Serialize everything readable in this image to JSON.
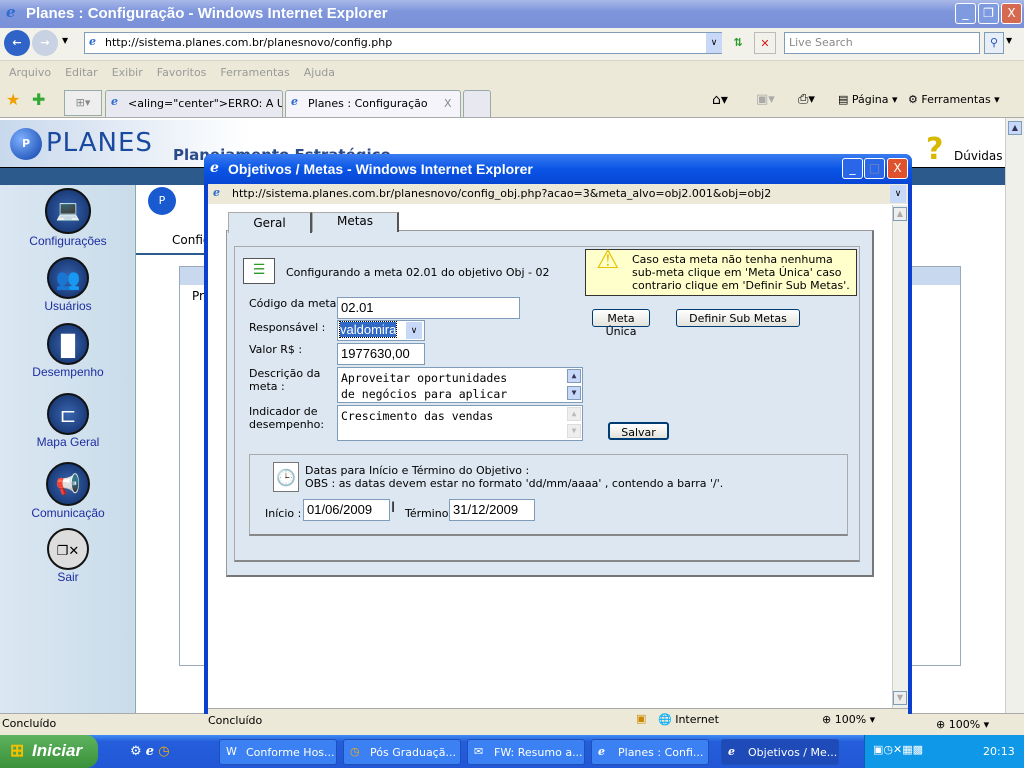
{
  "browser": {
    "title": "Planes : Configuração - Windows Internet Explorer",
    "url": "http://sistema.planes.com.br/planesnovo/config.php",
    "search_placeholder": "Live Search",
    "menu": [
      "Arquivo",
      "Editar",
      "Exibir",
      "Favoritos",
      "Ferramentas",
      "Ajuda"
    ],
    "tabs": [
      {
        "label": "<aling=\"center\">ERRO: A U..."
      },
      {
        "label": "Planes : Configuração",
        "close": "X"
      }
    ],
    "toolbar": {
      "page": "Página",
      "tools": "Ferramentas"
    },
    "status": "Concluído",
    "zoom": "100%"
  },
  "site": {
    "logo": "PLANES",
    "header_title": "Planejamento Estratégico",
    "help": "Dúvidas",
    "nav": [
      {
        "label": "Configurações"
      },
      {
        "label": "Usuários"
      },
      {
        "label": "Desempenho"
      },
      {
        "label": "Mapa Geral"
      },
      {
        "label": "Comunicação"
      },
      {
        "label": "Sair"
      }
    ],
    "content_tab": "Configurações",
    "content_col": "Pr"
  },
  "popup": {
    "title": "Objetivos / Metas - Windows Internet Explorer",
    "url": "http://sistema.planes.com.br/planesnovo/config_obj.php?acao=3&meta_alvo=obj2.001&obj=obj2",
    "tabs": [
      "Geral",
      "Metas"
    ],
    "heading": "Configurando a meta 02.01 do objetivo Obj - 02",
    "warning": "Caso esta meta não tenha nenhuma sub-meta clique em 'Meta Única' caso  contrario clique em 'Definir Sub Metas'.",
    "fields": {
      "codigo_label": "Código da meta :",
      "codigo": "02.01",
      "resp_label": "Responsável :",
      "resp": "valdomira",
      "valor_label": "Valor R$ :",
      "valor": "1977630,00",
      "desc_label": "Descrição da meta :",
      "desc": "Aproveitar oportunidades\nde negócios para aplicar",
      "ind_label": "Indicador de desempenho:",
      "ind": "Crescimento das vendas"
    },
    "buttons": {
      "meta_unica": "Meta Única",
      "sub_metas": "Definir Sub Metas",
      "salvar": "Salvar"
    },
    "dates": {
      "title": "Datas para Início e Término do Objetivo :",
      "obs": "OBS : as datas devem estar no formato 'dd/mm/aaaa' , contendo a barra '/'.",
      "inicio_label": "Início :",
      "inicio": "01/06/2009",
      "termino_label": "Término :",
      "termino": "31/12/2009"
    },
    "status": "Concluído",
    "zone": "Internet",
    "zoom": "100%"
  },
  "taskbar": {
    "start": "Iniciar",
    "tasks": [
      "Conforme Hos...",
      "Pós Graduaçã...",
      "FW: Resumo a...",
      "Planes : Confi...",
      "Objetivos / Me..."
    ],
    "clock": "20:13"
  }
}
